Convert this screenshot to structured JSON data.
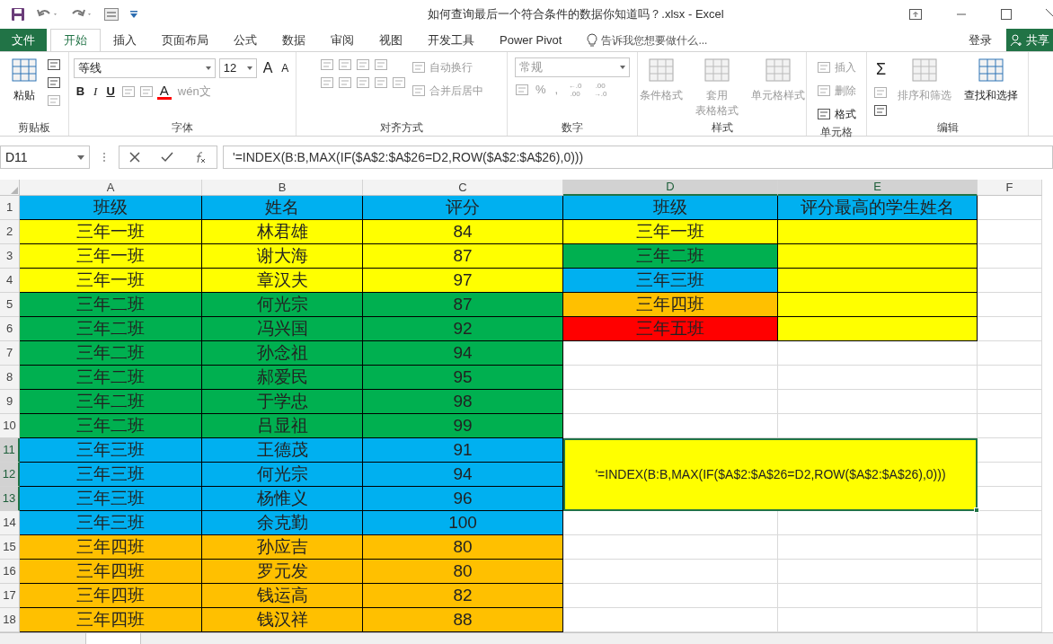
{
  "window": {
    "title": "如何查询最后一个符合条件的数据你知道吗？.xlsx - Excel"
  },
  "file_tab": "文件",
  "tabs": [
    {
      "label": "开始",
      "selected": true
    },
    {
      "label": "插入",
      "selected": false
    },
    {
      "label": "页面布局",
      "selected": false
    },
    {
      "label": "公式",
      "selected": false
    },
    {
      "label": "数据",
      "selected": false
    },
    {
      "label": "审阅",
      "selected": false
    },
    {
      "label": "视图",
      "selected": false
    },
    {
      "label": "开发工具",
      "selected": false
    },
    {
      "label": "Power Pivot",
      "selected": false
    }
  ],
  "tell_me": {
    "placeholder": "告诉我您想要做什么..."
  },
  "sign_in": "登录",
  "share": "共享",
  "ribbon_groups": [
    {
      "label": "剪贴板",
      "columns": [
        [
          [
            {
              "kind": "large",
              "lines": [
                "粘贴"
              ],
              "disabled": false
            }
          ]
        ],
        [
          [
            {
              "kind": "icon",
              "disabled": false
            }
          ],
          [
            {
              "kind": "icon",
              "disabled": false
            }
          ],
          [
            {
              "kind": "icon",
              "disabled": true
            }
          ]
        ]
      ]
    },
    {
      "label": "字体",
      "columns": [
        [
          [
            {
              "kind": "fontfield",
              "label": "等线",
              "disabled": false
            },
            {
              "kind": "sizefield",
              "label": "12",
              "disabled": false
            },
            {
              "kind": "grow",
              "label": "A",
              "disabled": false
            },
            {
              "kind": "shrink",
              "label": "A",
              "disabled": false
            }
          ],
          [
            {
              "kind": "bold",
              "label": "B",
              "disabled": false
            },
            {
              "kind": "italic",
              "label": "I",
              "disabled": false
            },
            {
              "kind": "underline",
              "label": "U",
              "disabled": false
            },
            {
              "kind": "icon",
              "disabled": true
            },
            {
              "kind": "icon",
              "disabled": true
            },
            {
              "kind": "fontcolor",
              "label": "A",
              "disabled": false
            },
            {
              "kind": "text",
              "label": "wén文",
              "disabled": true
            }
          ]
        ]
      ]
    },
    {
      "label": "对齐方式",
      "columns": [
        [
          [
            {
              "kind": "icon",
              "disabled": true
            },
            {
              "kind": "icon",
              "disabled": true
            },
            {
              "kind": "icon",
              "disabled": true
            },
            {
              "kind": "icon",
              "disabled": true
            }
          ],
          [
            {
              "kind": "icon",
              "disabled": true
            },
            {
              "kind": "icon",
              "disabled": true
            },
            {
              "kind": "icon",
              "disabled": true
            },
            {
              "kind": "icon",
              "disabled": true
            },
            {
              "kind": "icon",
              "disabled": true
            }
          ]
        ],
        [
          [
            {
              "kind": "small",
              "label": "自动换行",
              "disabled": true
            }
          ],
          [
            {
              "kind": "small",
              "label": "合并后居中",
              "disabled": true
            }
          ]
        ]
      ]
    },
    {
      "label": "数字",
      "columns": [
        [
          [
            {
              "kind": "numberfield",
              "label": "常规",
              "disabled": true
            }
          ],
          [
            {
              "kind": "icon",
              "disabled": true
            },
            {
              "kind": "text",
              "label": "%",
              "disabled": true
            },
            {
              "kind": "text",
              "label": ",",
              "disabled": true
            },
            {
              "kind": "tiny",
              "label": "←.0 .00",
              "disabled": true
            },
            {
              "kind": "tiny",
              "label": ".00 →.0",
              "disabled": true
            }
          ]
        ]
      ]
    },
    {
      "label": "样式",
      "columns": [
        [
          [
            {
              "kind": "large",
              "lines": [
                "条件格式"
              ],
              "disabled": true
            }
          ]
        ],
        [
          [
            {
              "kind": "large",
              "lines": [
                "套用",
                "表格格式"
              ],
              "disabled": true
            }
          ]
        ],
        [
          [
            {
              "kind": "large",
              "lines": [
                "单元格样式"
              ],
              "disabled": true
            }
          ]
        ]
      ]
    },
    {
      "label": "单元格",
      "columns": [
        [
          [
            {
              "kind": "small",
              "label": "插入",
              "disabled": true
            }
          ],
          [
            {
              "kind": "small",
              "label": "删除",
              "disabled": true
            }
          ],
          [
            {
              "kind": "small",
              "label": "格式",
              "disabled": false
            }
          ]
        ]
      ]
    },
    {
      "label": "编辑",
      "columns": [
        [
          [
            {
              "kind": "sigma",
              "label": "Σ",
              "disabled": false
            }
          ],
          [
            {
              "kind": "icon",
              "disabled": true
            }
          ],
          [
            {
              "kind": "icon",
              "disabled": false
            }
          ]
        ],
        [
          [
            {
              "kind": "large",
              "lines": [
                "排序和筛选"
              ],
              "disabled": true
            }
          ]
        ],
        [
          [
            {
              "kind": "large",
              "lines": [
                "查找和选择"
              ],
              "disabled": false
            }
          ]
        ]
      ]
    }
  ],
  "name_box": "D11",
  "formula": "'=INDEX(B:B,MAX(IF($A$2:$A$26=D2,ROW($A$2:$A$26),0)))",
  "sheet": {
    "columns": [
      {
        "label": "A",
        "selected": false
      },
      {
        "label": "B",
        "selected": false
      },
      {
        "label": "C",
        "selected": false
      },
      {
        "label": "D",
        "selected": true
      },
      {
        "label": "E",
        "selected": true
      },
      {
        "label": "F",
        "selected": false
      }
    ],
    "rows": [
      {
        "number": "1",
        "selected": false,
        "cells": [
          {
            "text": "班级",
            "color": "#00b0f0"
          },
          {
            "text": "姓名",
            "color": "#00b0f0"
          },
          {
            "text": "评分",
            "color": "#00b0f0"
          },
          {
            "text": "班级",
            "color": "#00b0f0"
          },
          {
            "text": "评分最高的学生姓名",
            "color": "#00b0f0"
          }
        ]
      },
      {
        "number": "2",
        "selected": false,
        "cells": [
          {
            "text": "三年一班",
            "color": "#ffff00"
          },
          {
            "text": "林君雄",
            "color": "#ffff00"
          },
          {
            "text": "84",
            "color": "#ffff00"
          },
          {
            "text": "三年一班",
            "color": "#ffff00"
          },
          {
            "color": "#ffff00"
          }
        ]
      },
      {
        "number": "3",
        "selected": false,
        "cells": [
          {
            "text": "三年一班",
            "color": "#ffff00"
          },
          {
            "text": "谢大海",
            "color": "#ffff00"
          },
          {
            "text": "87",
            "color": "#ffff00"
          },
          {
            "text": "三年二班",
            "color": "#00b050"
          },
          {
            "color": "#ffff00"
          }
        ]
      },
      {
        "number": "4",
        "selected": false,
        "cells": [
          {
            "text": "三年一班",
            "color": "#ffff00"
          },
          {
            "text": "章汉夫",
            "color": "#ffff00"
          },
          {
            "text": "97",
            "color": "#ffff00"
          },
          {
            "text": "三年三班",
            "color": "#00b0f0"
          },
          {
            "color": "#ffff00"
          }
        ]
      },
      {
        "number": "5",
        "selected": false,
        "cells": [
          {
            "text": "三年二班",
            "color": "#00b050"
          },
          {
            "text": "何光宗",
            "color": "#00b050"
          },
          {
            "text": "87",
            "color": "#00b050"
          },
          {
            "text": "三年四班",
            "color": "#ffc000"
          },
          {
            "color": "#ffff00"
          }
        ]
      },
      {
        "number": "6",
        "selected": false,
        "cells": [
          {
            "text": "三年二班",
            "color": "#00b050"
          },
          {
            "text": "冯兴国",
            "color": "#00b050"
          },
          {
            "text": "92",
            "color": "#00b050"
          },
          {
            "text": "三年五班",
            "color": "#ff0000"
          },
          {
            "color": "#ffff00"
          }
        ]
      },
      {
        "number": "7",
        "selected": false,
        "cells": [
          {
            "text": "三年二班",
            "color": "#00b050"
          },
          {
            "text": "孙念祖",
            "color": "#00b050"
          },
          {
            "text": "94",
            "color": "#00b050"
          }
        ]
      },
      {
        "number": "8",
        "selected": false,
        "cells": [
          {
            "text": "三年二班",
            "color": "#00b050"
          },
          {
            "text": "郝爱民",
            "color": "#00b050"
          },
          {
            "text": "95",
            "color": "#00b050"
          }
        ]
      },
      {
        "number": "9",
        "selected": false,
        "cells": [
          {
            "text": "三年二班",
            "color": "#00b050"
          },
          {
            "text": "于学忠",
            "color": "#00b050"
          },
          {
            "text": "98",
            "color": "#00b050"
          }
        ]
      },
      {
        "number": "10",
        "selected": false,
        "cells": [
          {
            "text": "三年二班",
            "color": "#00b050"
          },
          {
            "text": "吕显祖",
            "color": "#00b050"
          },
          {
            "text": "99",
            "color": "#00b050"
          }
        ]
      },
      {
        "number": "11",
        "selected": true,
        "cells": [
          {
            "text": "三年三班",
            "color": "#00b0f0"
          },
          {
            "text": "王德茂",
            "color": "#00b0f0"
          },
          {
            "text": "91",
            "color": "#00b0f0"
          }
        ]
      },
      {
        "number": "12",
        "selected": true,
        "cells": [
          {
            "text": "三年三班",
            "color": "#00b0f0"
          },
          {
            "text": "何光宗",
            "color": "#00b0f0"
          },
          {
            "text": "94",
            "color": "#00b0f0"
          }
        ]
      },
      {
        "number": "13",
        "selected": true,
        "cells": [
          {
            "text": "三年三班",
            "color": "#00b0f0"
          },
          {
            "text": "杨惟义",
            "color": "#00b0f0"
          },
          {
            "text": "96",
            "color": "#00b0f0"
          }
        ]
      },
      {
        "number": "14",
        "selected": false,
        "cells": [
          {
            "text": "三年三班",
            "color": "#00b0f0"
          },
          {
            "text": "余克勤",
            "color": "#00b0f0"
          },
          {
            "text": "100",
            "color": "#00b0f0"
          }
        ]
      },
      {
        "number": "15",
        "selected": false,
        "cells": [
          {
            "text": "三年四班",
            "color": "#ffc000"
          },
          {
            "text": "孙应吉",
            "color": "#ffc000"
          },
          {
            "text": "80",
            "color": "#ffc000"
          }
        ]
      },
      {
        "number": "16",
        "selected": false,
        "cells": [
          {
            "text": "三年四班",
            "color": "#ffc000"
          },
          {
            "text": "罗元发",
            "color": "#ffc000"
          },
          {
            "text": "80",
            "color": "#ffc000"
          }
        ]
      },
      {
        "number": "17",
        "selected": false,
        "cells": [
          {
            "text": "三年四班",
            "color": "#ffc000"
          },
          {
            "text": "钱运高",
            "color": "#ffc000"
          },
          {
            "text": "82",
            "color": "#ffc000"
          }
        ]
      },
      {
        "number": "18",
        "selected": false,
        "cells": [
          {
            "text": "三年四班",
            "color": "#ffc000"
          },
          {
            "text": "钱汉祥",
            "color": "#ffc000"
          },
          {
            "text": "88",
            "color": "#ffc000"
          }
        ]
      }
    ],
    "merged_cell": {
      "text": "'=INDEX(B:B,MAX(IF($A$2:$A$26=D2,ROW($A$2:$A$26),0)))",
      "color": "#ffff00",
      "selected": true
    }
  }
}
